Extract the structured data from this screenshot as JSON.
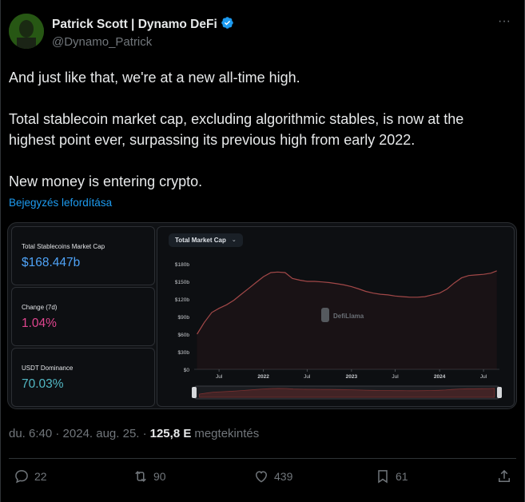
{
  "author": {
    "display_name": "Patrick Scott | Dynamo DeFi",
    "handle": "@Dynamo_Patrick",
    "verified": true
  },
  "tweet": {
    "line1": "And just like that, we're at a new all-time high.",
    "line2": "Total stablecoin market cap, excluding algorithmic stables, is now at the highest point ever, surpassing its previous high from early 2022.",
    "line3": "New money is entering crypto.",
    "translate_label": "Bejegyzés lefordítása"
  },
  "card": {
    "stats": [
      {
        "label": "Total Stablecoins Market Cap",
        "value": "$168.447b",
        "color": "#4fa3f7"
      },
      {
        "label": "Change (7d)",
        "value": "1.04%",
        "color": "#e0458f"
      },
      {
        "label": "USDT Dominance",
        "value": "70.03%",
        "color": "#52b8c4"
      }
    ],
    "dropdown_label": "Total Market Cap",
    "watermark": "DefiLlama"
  },
  "chart_data": {
    "type": "area",
    "title": "",
    "xlabel": "",
    "ylabel": "",
    "yticks": [
      "$0",
      "$30b",
      "$60b",
      "$90b",
      "$120b",
      "$150b",
      "$180b"
    ],
    "xticks": [
      "Jul",
      "2022",
      "Jul",
      "2023",
      "Jul",
      "2024",
      "Jul"
    ],
    "ylim": [
      0,
      180
    ],
    "x": [
      "2021-04-01",
      "2021-05-01",
      "2021-06-01",
      "2021-07-01",
      "2021-08-01",
      "2021-09-01",
      "2021-10-01",
      "2021-11-01",
      "2021-12-01",
      "2022-01-01",
      "2022-02-01",
      "2022-03-01",
      "2022-04-01",
      "2022-05-01",
      "2022-06-01",
      "2022-07-01",
      "2022-08-01",
      "2022-09-01",
      "2022-10-01",
      "2022-11-01",
      "2022-12-01",
      "2023-01-01",
      "2023-02-01",
      "2023-03-01",
      "2023-04-01",
      "2023-05-01",
      "2023-06-01",
      "2023-07-01",
      "2023-08-01",
      "2023-09-01",
      "2023-10-01",
      "2023-11-01",
      "2023-12-01",
      "2024-01-01",
      "2024-02-01",
      "2024-03-01",
      "2024-04-01",
      "2024-05-01",
      "2024-06-01",
      "2024-07-01",
      "2024-08-01",
      "2024-08-25"
    ],
    "series": [
      {
        "values": [
          60,
          80,
          97,
          104,
          110,
          118,
          128,
          138,
          148,
          158,
          165,
          166,
          165,
          155,
          152,
          150,
          150,
          149,
          148,
          146,
          144,
          141,
          137,
          133,
          130,
          128,
          127,
          125,
          124,
          123,
          123,
          124,
          127,
          130,
          137,
          147,
          156,
          160,
          161,
          162,
          164,
          168
        ]
      }
    ]
  },
  "footer": {
    "time": "du. 6:40 · 2024. aug. 25. ·",
    "views_count": "125,8 E",
    "views_label": "megtekintés",
    "replies": "22",
    "reposts": "90",
    "likes": "439",
    "bookmarks": "61"
  }
}
